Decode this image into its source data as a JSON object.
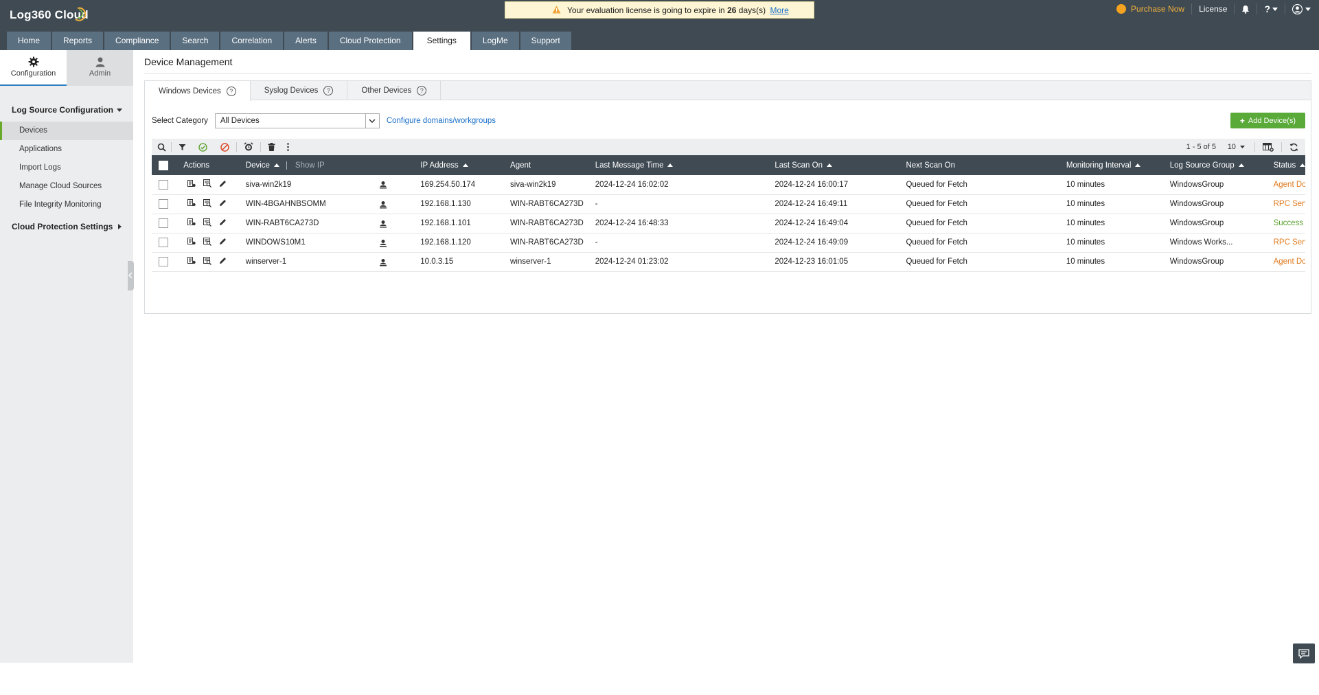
{
  "app": {
    "logo": "Log360 Cloud",
    "license_text_pre": "Your evaluation license is going to expire in",
    "license_days": "26",
    "license_text_post": "days(s)",
    "license_link": "More",
    "purchase": "Purchase Now",
    "license_menu": "License",
    "help": "?"
  },
  "nav": {
    "tabs": [
      "Home",
      "Reports",
      "Compliance",
      "Search",
      "Correlation",
      "Alerts",
      "Cloud Protection",
      "Settings",
      "LogMe",
      "Support"
    ],
    "active": "Settings"
  },
  "sidebar": {
    "switch": {
      "config": "Configuration",
      "admin": "Admin"
    },
    "section1": "Log Source Configuration",
    "items": [
      "Devices",
      "Applications",
      "Import Logs",
      "Manage Cloud Sources",
      "File Integrity Monitoring"
    ],
    "section2": "Cloud Protection Settings"
  },
  "main": {
    "title": "Device Management",
    "subtabs": [
      "Windows Devices",
      "Syslog Devices",
      "Other Devices"
    ],
    "category_label": "Select Category",
    "category_value": "All Devices",
    "configure_link": "Configure domains/workgroups",
    "add_button": "Add Device(s)",
    "pager": "1 - 5 of 5",
    "page_size": "10"
  },
  "table": {
    "headers": {
      "actions": "Actions",
      "device": "Device",
      "show_ip": "Show IP",
      "ip": "IP Address",
      "agent": "Agent",
      "last_msg": "Last Message Time",
      "last_scan": "Last Scan On",
      "next_scan": "Next Scan On",
      "interval": "Monitoring Interval",
      "group": "Log Source Group",
      "status": "Status"
    },
    "rows": [
      {
        "device": "siva-win2k19",
        "ip": "169.254.50.174",
        "agent": "siva-win2k19",
        "last_msg": "2024-12-24 16:02:02",
        "last_scan": "2024-12-24 16:00:17",
        "next_scan": "Queued for Fetch",
        "interval": "10 minutes",
        "group": "WindowsGroup",
        "status": "Agent Dow",
        "status_color": "#e07b1f"
      },
      {
        "device": "WIN-4BGAHNBSOMM",
        "ip": "192.168.1.130",
        "agent": "WIN-RABT6CA273D",
        "last_msg": "-",
        "last_scan": "2024-12-24 16:49:11",
        "next_scan": "Queued for Fetch",
        "interval": "10 minutes",
        "group": "WindowsGroup",
        "status": "RPC Serv",
        "status_color": "#e07b1f"
      },
      {
        "device": "WIN-RABT6CA273D",
        "ip": "192.168.1.101",
        "agent": "WIN-RABT6CA273D",
        "last_msg": "2024-12-24 16:48:33",
        "last_scan": "2024-12-24 16:49:04",
        "next_scan": "Queued for Fetch",
        "interval": "10 minutes",
        "group": "WindowsGroup",
        "status": "Success",
        "status_color": "#5aa02c"
      },
      {
        "device": "WINDOWS10M1",
        "ip": "192.168.1.120",
        "agent": "WIN-RABT6CA273D",
        "last_msg": "-",
        "last_scan": "2024-12-24 16:49:09",
        "next_scan": "Queued for Fetch",
        "interval": "10 minutes",
        "group": "Windows Works...",
        "status": "RPC Serv",
        "status_color": "#e07b1f"
      },
      {
        "device": "winserver-1",
        "ip": "10.0.3.15",
        "agent": "winserver-1",
        "last_msg": "2024-12-24 01:23:02",
        "last_scan": "2024-12-23 16:01:05",
        "next_scan": "Queued for Fetch",
        "interval": "10 minutes",
        "group": "WindowsGroup",
        "status": "Agent Dow",
        "status_color": "#e07b1f"
      }
    ]
  },
  "icons": {
    "toolbar": [
      "search-icon",
      "filter-icon",
      "enable-icon",
      "disable-icon",
      "alarm-icon",
      "delete-icon",
      "more-icon"
    ],
    "row_actions": [
      "device-details-icon",
      "view-logs-icon",
      "edit-icon",
      "agent-icon"
    ]
  }
}
